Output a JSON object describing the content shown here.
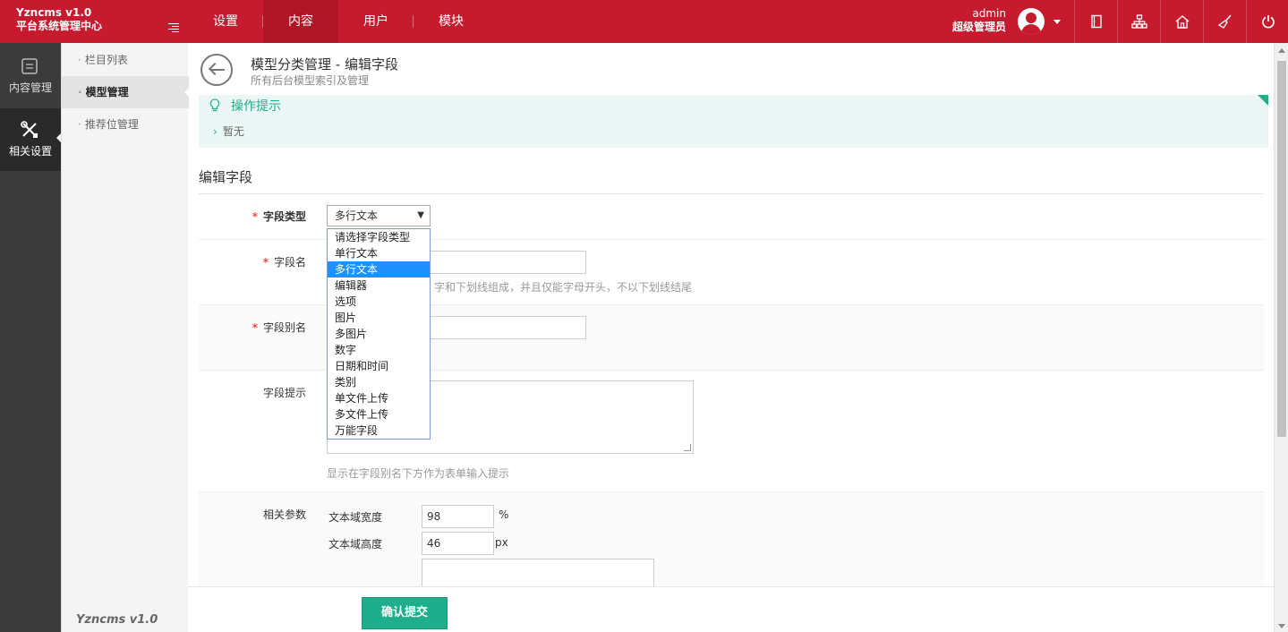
{
  "header": {
    "brand_line1": "Yzncms v1.0",
    "brand_line2": "平台系统管理中心",
    "nav": [
      "设置",
      "内容",
      "用户",
      "模块"
    ],
    "active_nav": "内容",
    "user_name": "admin",
    "user_role": "超级管理员",
    "icons": [
      "book-icon",
      "sitemap-icon",
      "home-icon",
      "broom-icon",
      "power-icon"
    ]
  },
  "sidebar": {
    "main_items": [
      "内容管理",
      "相关设置"
    ],
    "active_main": "相关设置",
    "sub_items": [
      "栏目列表",
      "模型管理",
      "推荐位管理"
    ],
    "active_sub": "模型管理",
    "footer": "Yzncms v1.0"
  },
  "page": {
    "title": "模型分类管理 - 编辑字段",
    "subtitle": "所有后台模型索引及管理"
  },
  "tips": {
    "title": "操作提示",
    "items": [
      "暂无"
    ]
  },
  "form": {
    "section_title": "编辑字段",
    "field_type": {
      "label": "字段类型",
      "value": "多行文本",
      "arrow": "▼",
      "options": [
        "请选择字段类型",
        "单行文本",
        "多行文本",
        "编辑器",
        "选项",
        "图片",
        "多图片",
        "数字",
        "日期和时间",
        "类别",
        "单文件上传",
        "多文件上传",
        "万能字段"
      ],
      "selected_index": 2
    },
    "field_name": {
      "label": "字段名",
      "hint": "字和下划线组成，并且仅能字母开头，不以下划线结尾"
    },
    "field_alias": {
      "label": "字段别名"
    },
    "field_tip": {
      "label": "字段提示",
      "hint": "显示在字段别名下方作为表单输入提示"
    },
    "params": {
      "label": "相关参数",
      "width_label": "文本域宽度",
      "width_value": "98",
      "width_unit": "%",
      "height_label": "文本域高度",
      "height_value": "46",
      "height_unit": "px"
    },
    "submit_label": "确认提交"
  },
  "colors": {
    "brand_red": "#c61a2e",
    "accent_green": "#1fae8c",
    "selected_blue": "#1e90ff"
  }
}
